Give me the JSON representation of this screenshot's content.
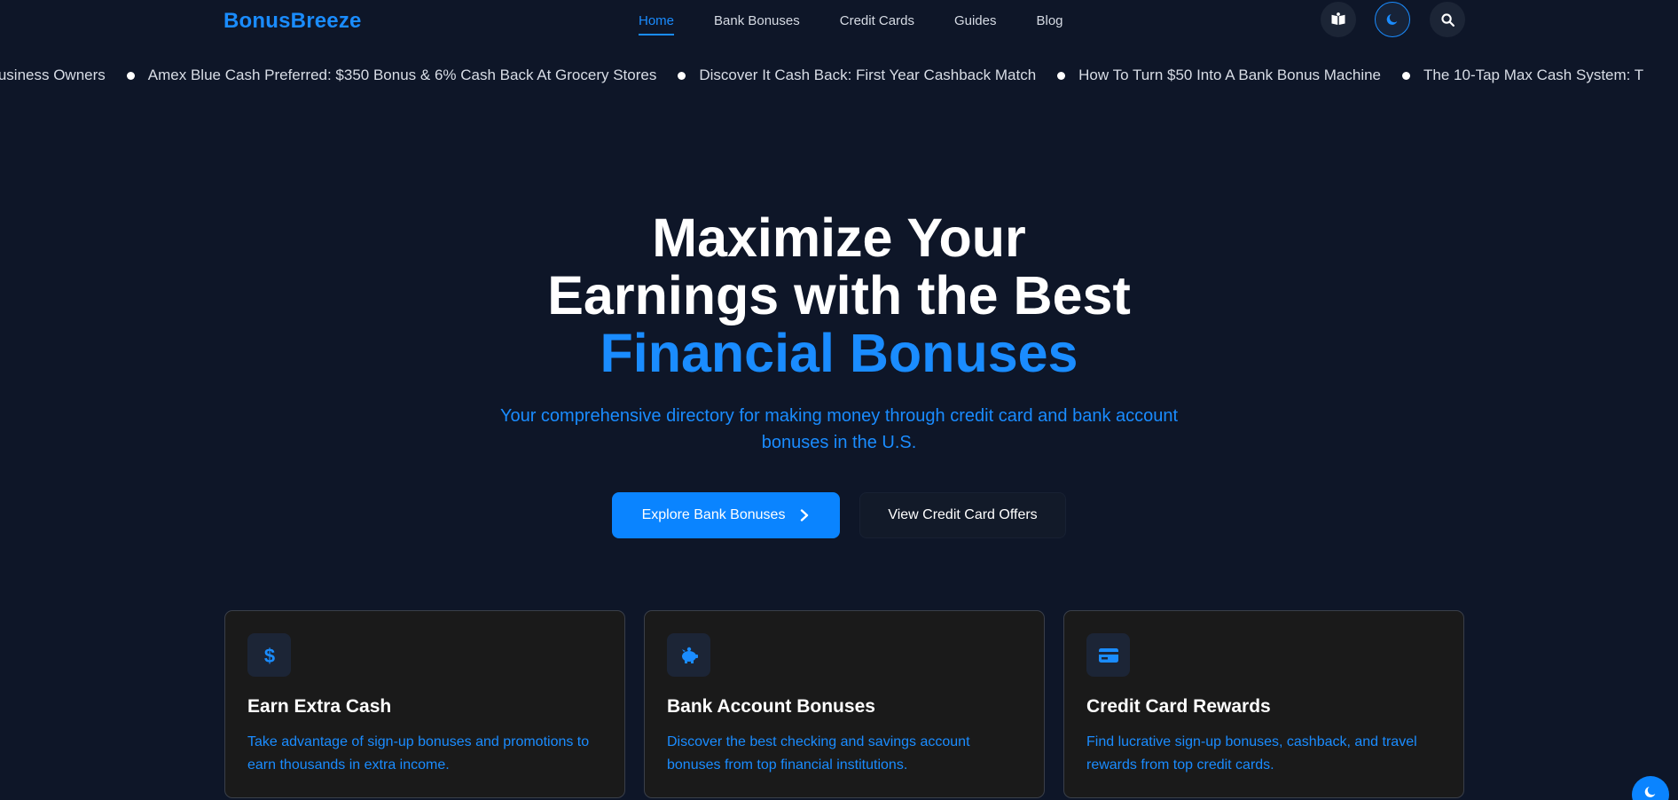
{
  "brand": {
    "name": "BonusBreeze",
    "accent_color": "#1a8cff"
  },
  "nav": {
    "items": [
      {
        "label": "Home",
        "active": true
      },
      {
        "label": "Bank Bonuses",
        "active": false
      },
      {
        "label": "Credit Cards",
        "active": false
      },
      {
        "label": "Guides",
        "active": false
      },
      {
        "label": "Blog",
        "active": false
      }
    ],
    "icons": [
      "book-icon",
      "moon-icon",
      "search-icon"
    ]
  },
  "ticker": {
    "items": [
      "l Business Owners",
      "Amex Blue Cash Preferred: $350 Bonus & 6% Cash Back At Grocery Stores",
      "Discover It Cash Back: First Year Cashback Match",
      "How To Turn $50 Into A Bank Bonus Machine",
      "The 10-Tap Max Cash System: T"
    ]
  },
  "hero": {
    "title_line1": "Maximize Your",
    "title_line2": "Earnings with the Best",
    "title_accent": "Financial Bonuses",
    "subtitle": "Your comprehensive directory for making money through credit card and bank account bonuses in the U.S.",
    "primary_cta": "Explore Bank Bonuses",
    "secondary_cta": "View Credit Card Offers"
  },
  "features": [
    {
      "icon": "dollar-icon",
      "title": "Earn Extra Cash",
      "description": "Take advantage of sign-up bonuses and promotions to earn thousands in extra income."
    },
    {
      "icon": "piggy-bank-icon",
      "title": "Bank Account Bonuses",
      "description": "Discover the best checking and savings account bonuses from top financial institutions."
    },
    {
      "icon": "credit-card-icon",
      "title": "Credit Card Rewards",
      "description": "Find lucrative sign-up bonuses, cashback, and travel rewards from top credit cards."
    }
  ],
  "colors": {
    "background": "#0e1628",
    "card_bg": "#1a1a1a",
    "primary_button": "#0a84ff"
  }
}
